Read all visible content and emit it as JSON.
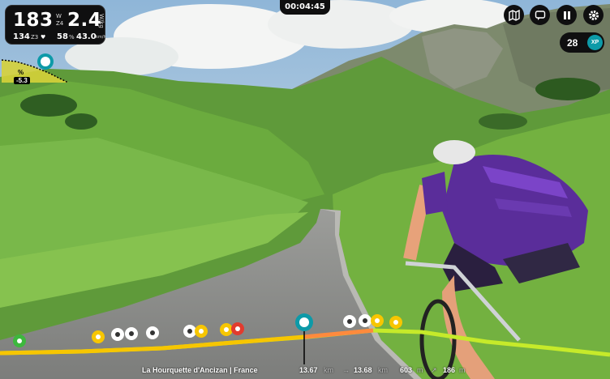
{
  "hud": {
    "power": "183",
    "power_zone": "Z4",
    "power_unit": "W",
    "wkg": "2.4",
    "wkg_unit": "W/kg",
    "heart_rate": "134",
    "hr_zone": "Z3",
    "cadence": "58",
    "cadence_unit": "%",
    "speed": "43.0",
    "speed_unit": "km/h"
  },
  "timer": "00:04:45",
  "gradient": {
    "label": "%",
    "value": "-5.3"
  },
  "xp": {
    "value": "28",
    "badge": "XP"
  },
  "route": {
    "name": "La Hourquette d'Ancizan | France",
    "distance": "13.67",
    "distance_unit": "km",
    "total_distance": "13.68",
    "total_unit": "km",
    "elevation": "603",
    "elevation_unit": "m",
    "climb_remaining": "186",
    "climb_unit": "m"
  },
  "icons": [
    "map-icon",
    "chat-icon",
    "pause-icon",
    "settings-icon",
    "heart-icon",
    "avatar-marker-icon"
  ],
  "colors": {
    "accent": "#0d9aa8",
    "progress": "#f7c600",
    "remaining": "#c6ea2a",
    "panel": "#0f0f10"
  }
}
